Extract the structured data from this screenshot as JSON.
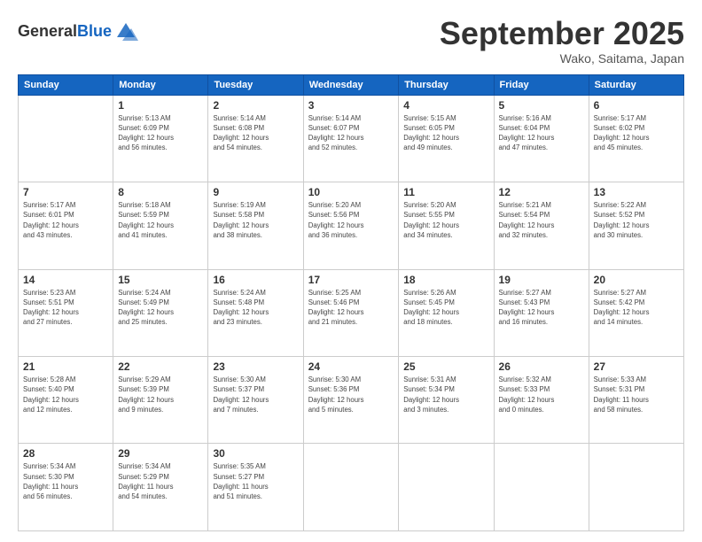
{
  "header": {
    "logo_general": "General",
    "logo_blue": "Blue",
    "month_title": "September 2025",
    "location": "Wako, Saitama, Japan"
  },
  "weekdays": [
    "Sunday",
    "Monday",
    "Tuesday",
    "Wednesday",
    "Thursday",
    "Friday",
    "Saturday"
  ],
  "weeks": [
    [
      {
        "day": "",
        "info": ""
      },
      {
        "day": "1",
        "info": "Sunrise: 5:13 AM\nSunset: 6:09 PM\nDaylight: 12 hours\nand 56 minutes."
      },
      {
        "day": "2",
        "info": "Sunrise: 5:14 AM\nSunset: 6:08 PM\nDaylight: 12 hours\nand 54 minutes."
      },
      {
        "day": "3",
        "info": "Sunrise: 5:14 AM\nSunset: 6:07 PM\nDaylight: 12 hours\nand 52 minutes."
      },
      {
        "day": "4",
        "info": "Sunrise: 5:15 AM\nSunset: 6:05 PM\nDaylight: 12 hours\nand 49 minutes."
      },
      {
        "day": "5",
        "info": "Sunrise: 5:16 AM\nSunset: 6:04 PM\nDaylight: 12 hours\nand 47 minutes."
      },
      {
        "day": "6",
        "info": "Sunrise: 5:17 AM\nSunset: 6:02 PM\nDaylight: 12 hours\nand 45 minutes."
      }
    ],
    [
      {
        "day": "7",
        "info": "Sunrise: 5:17 AM\nSunset: 6:01 PM\nDaylight: 12 hours\nand 43 minutes."
      },
      {
        "day": "8",
        "info": "Sunrise: 5:18 AM\nSunset: 5:59 PM\nDaylight: 12 hours\nand 41 minutes."
      },
      {
        "day": "9",
        "info": "Sunrise: 5:19 AM\nSunset: 5:58 PM\nDaylight: 12 hours\nand 38 minutes."
      },
      {
        "day": "10",
        "info": "Sunrise: 5:20 AM\nSunset: 5:56 PM\nDaylight: 12 hours\nand 36 minutes."
      },
      {
        "day": "11",
        "info": "Sunrise: 5:20 AM\nSunset: 5:55 PM\nDaylight: 12 hours\nand 34 minutes."
      },
      {
        "day": "12",
        "info": "Sunrise: 5:21 AM\nSunset: 5:54 PM\nDaylight: 12 hours\nand 32 minutes."
      },
      {
        "day": "13",
        "info": "Sunrise: 5:22 AM\nSunset: 5:52 PM\nDaylight: 12 hours\nand 30 minutes."
      }
    ],
    [
      {
        "day": "14",
        "info": "Sunrise: 5:23 AM\nSunset: 5:51 PM\nDaylight: 12 hours\nand 27 minutes."
      },
      {
        "day": "15",
        "info": "Sunrise: 5:24 AM\nSunset: 5:49 PM\nDaylight: 12 hours\nand 25 minutes."
      },
      {
        "day": "16",
        "info": "Sunrise: 5:24 AM\nSunset: 5:48 PM\nDaylight: 12 hours\nand 23 minutes."
      },
      {
        "day": "17",
        "info": "Sunrise: 5:25 AM\nSunset: 5:46 PM\nDaylight: 12 hours\nand 21 minutes."
      },
      {
        "day": "18",
        "info": "Sunrise: 5:26 AM\nSunset: 5:45 PM\nDaylight: 12 hours\nand 18 minutes."
      },
      {
        "day": "19",
        "info": "Sunrise: 5:27 AM\nSunset: 5:43 PM\nDaylight: 12 hours\nand 16 minutes."
      },
      {
        "day": "20",
        "info": "Sunrise: 5:27 AM\nSunset: 5:42 PM\nDaylight: 12 hours\nand 14 minutes."
      }
    ],
    [
      {
        "day": "21",
        "info": "Sunrise: 5:28 AM\nSunset: 5:40 PM\nDaylight: 12 hours\nand 12 minutes."
      },
      {
        "day": "22",
        "info": "Sunrise: 5:29 AM\nSunset: 5:39 PM\nDaylight: 12 hours\nand 9 minutes."
      },
      {
        "day": "23",
        "info": "Sunrise: 5:30 AM\nSunset: 5:37 PM\nDaylight: 12 hours\nand 7 minutes."
      },
      {
        "day": "24",
        "info": "Sunrise: 5:30 AM\nSunset: 5:36 PM\nDaylight: 12 hours\nand 5 minutes."
      },
      {
        "day": "25",
        "info": "Sunrise: 5:31 AM\nSunset: 5:34 PM\nDaylight: 12 hours\nand 3 minutes."
      },
      {
        "day": "26",
        "info": "Sunrise: 5:32 AM\nSunset: 5:33 PM\nDaylight: 12 hours\nand 0 minutes."
      },
      {
        "day": "27",
        "info": "Sunrise: 5:33 AM\nSunset: 5:31 PM\nDaylight: 11 hours\nand 58 minutes."
      }
    ],
    [
      {
        "day": "28",
        "info": "Sunrise: 5:34 AM\nSunset: 5:30 PM\nDaylight: 11 hours\nand 56 minutes."
      },
      {
        "day": "29",
        "info": "Sunrise: 5:34 AM\nSunset: 5:29 PM\nDaylight: 11 hours\nand 54 minutes."
      },
      {
        "day": "30",
        "info": "Sunrise: 5:35 AM\nSunset: 5:27 PM\nDaylight: 11 hours\nand 51 minutes."
      },
      {
        "day": "",
        "info": ""
      },
      {
        "day": "",
        "info": ""
      },
      {
        "day": "",
        "info": ""
      },
      {
        "day": "",
        "info": ""
      }
    ]
  ]
}
